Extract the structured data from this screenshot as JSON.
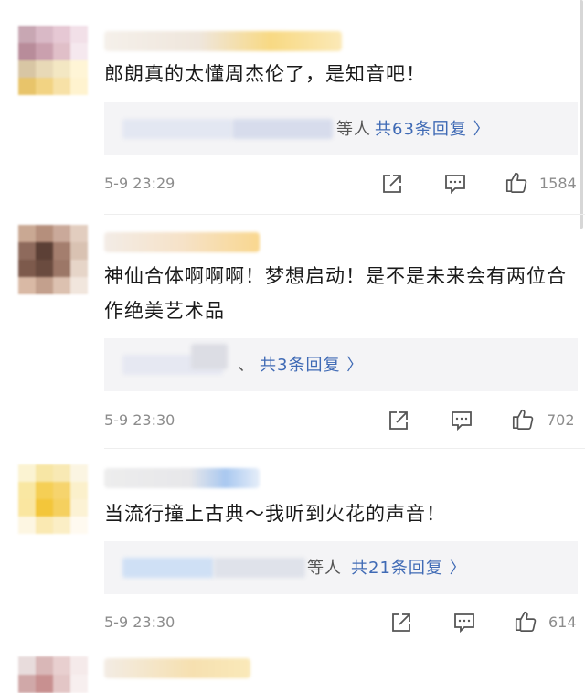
{
  "comments": [
    {
      "text": "郎朗真的太懂周杰伦了，是知音吧！",
      "reply_prefix": "等人",
      "reply_link": "共63条回复 〉",
      "time": "5-9 23:29",
      "likes": "1584"
    },
    {
      "text": "神仙合体啊啊啊！梦想启动！是不是未来会有两位合作绝美艺术品",
      "reply_prefix": "、",
      "reply_link": "共3条回复 〉",
      "time": "5-9 23:30",
      "likes": "702"
    },
    {
      "text": "当流行撞上古典～我听到火花的声音！",
      "reply_prefix": "等人",
      "reply_link": "共21条回复 〉",
      "time": "5-9 23:30",
      "likes": "614"
    }
  ],
  "icons": {
    "share": "share-icon",
    "comment": "comment-icon",
    "like": "like-icon"
  },
  "colors": {
    "link": "#3f6ab5",
    "meta": "#8c8c8c",
    "reply_bg": "#f4f4f6"
  }
}
